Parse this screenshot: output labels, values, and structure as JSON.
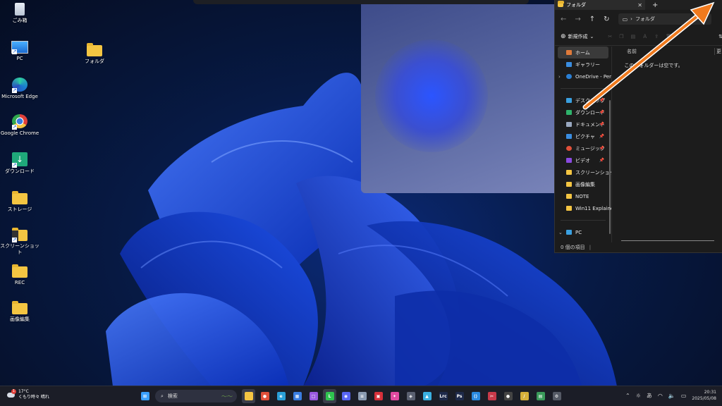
{
  "desktop": {
    "icons": [
      {
        "label": "ごみ箱",
        "icon": "recycle-bin-icon"
      },
      {
        "label": "PC",
        "icon": "pc-icon"
      },
      {
        "label": "Microsoft Edge",
        "icon": "edge-icon"
      },
      {
        "label": "Google Chrome",
        "icon": "chrome-icon"
      },
      {
        "label": "ダウンロード",
        "icon": "download-folder-icon"
      },
      {
        "label": "ストレージ",
        "icon": "folder-icon"
      },
      {
        "label": "スクリーンショット",
        "icon": "folder-icon"
      },
      {
        "label": "REC",
        "icon": "folder-icon"
      },
      {
        "label": "画像編集",
        "icon": "folder-icon"
      },
      {
        "label": "フォルダ",
        "icon": "folder-icon"
      }
    ]
  },
  "explorer": {
    "tab_title": "フォルダ",
    "breadcrumb": "フォルダ",
    "new_button": "新規作成",
    "sidebar": [
      {
        "label": "ホーム",
        "color": "#e07a3a"
      },
      {
        "label": "ギャラリー",
        "color": "#3a8de0"
      },
      {
        "label": "OneDrive - Pers",
        "color": "#2a7fd4"
      },
      {
        "label": "デスクトップ",
        "color": "#3aa0e0"
      },
      {
        "label": "ダウンロード",
        "color": "#2fb36b"
      },
      {
        "label": "ドキュメント",
        "color": "#9aa8c0"
      },
      {
        "label": "ピクチャ",
        "color": "#3a8de0"
      },
      {
        "label": "ミュージック",
        "color": "#e0503a"
      },
      {
        "label": "ビデオ",
        "color": "#8a4ae0"
      },
      {
        "label": "スクリーンショット",
        "color": "#f4c542"
      },
      {
        "label": "画像編集",
        "color": "#f4c542"
      },
      {
        "label": "NOTE",
        "color": "#f4c542"
      },
      {
        "label": "Win11 Explainec",
        "color": "#f4c542"
      },
      {
        "label": "PC",
        "color": "#3aa0e0"
      }
    ],
    "column_header": "名前",
    "column_header_2": "更",
    "empty_message": "このフォルダーは空です。",
    "status": "0 個の項目"
  },
  "taskbar": {
    "weather_temp": "17°C",
    "weather_desc": "くもり時々 晴れ",
    "weather_badge": "1",
    "search_placeholder": "検索",
    "apps": [
      {
        "name": "start",
        "color": "#3aa0ff",
        "glyph": "⊞"
      },
      {
        "name": "file-explorer",
        "color": "#f4c542",
        "glyph": ""
      },
      {
        "name": "chrome",
        "color": "#e0503a",
        "glyph": "●"
      },
      {
        "name": "edge",
        "color": "#2a9fd6",
        "glyph": "e"
      },
      {
        "name": "store",
        "color": "#3a7de0",
        "glyph": "▦"
      },
      {
        "name": "app-purple",
        "color": "#9a5ae0",
        "glyph": "□"
      },
      {
        "name": "line",
        "color": "#2fc34f",
        "glyph": "L"
      },
      {
        "name": "discord",
        "color": "#5865f2",
        "glyph": "◉"
      },
      {
        "name": "notepad",
        "color": "#8a9ab0",
        "glyph": "≡"
      },
      {
        "name": "app-red",
        "color": "#d6303a",
        "glyph": "▣"
      },
      {
        "name": "app-pink",
        "color": "#e04aa0",
        "glyph": "✦"
      },
      {
        "name": "app-gray",
        "color": "#5a6070",
        "glyph": "◈"
      },
      {
        "name": "photos",
        "color": "#3ab0e0",
        "glyph": "▲"
      },
      {
        "name": "lightroom",
        "color": "#1e2a4a",
        "glyph": "Lrc"
      },
      {
        "name": "photoshop",
        "color": "#1e2a4a",
        "glyph": "Ps"
      },
      {
        "name": "vscode",
        "color": "#2a8ae0",
        "glyph": "⟨⟩"
      },
      {
        "name": "snipping",
        "color": "#c83a4a",
        "glyph": "✂"
      },
      {
        "name": "app-dot",
        "color": "#444",
        "glyph": "●"
      },
      {
        "name": "app-pen",
        "color": "#d6b03a",
        "glyph": "/"
      },
      {
        "name": "app-green",
        "color": "#3a9a5a",
        "glyph": "▤"
      },
      {
        "name": "settings",
        "color": "#555a66",
        "glyph": "⚙"
      }
    ],
    "tray_ime": "あ",
    "time": "20:31",
    "date": "2025/05/08"
  }
}
